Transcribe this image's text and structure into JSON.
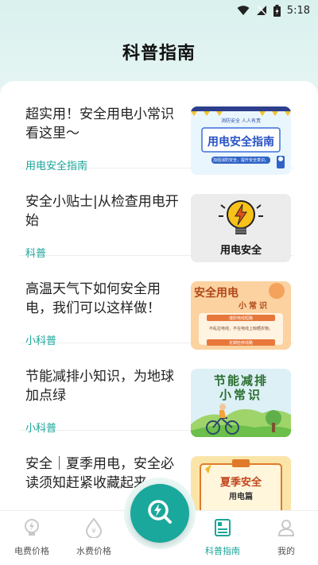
{
  "status_bar": {
    "time": "5:18"
  },
  "header": {
    "title": "科普指南"
  },
  "articles": [
    {
      "title": "超实用！安全用电小常识看这里～",
      "tag": "用电安全指南",
      "thumb": {
        "small": "消防安全 人人有责",
        "main": "用电安全指南",
        "note": "加强消防安全，提升安全意识。"
      }
    },
    {
      "title": "安全小贴士|从检查用电开始",
      "tag": "科普",
      "thumb": {
        "main": "用电安全"
      }
    },
    {
      "title": "高温天气下如何安全用电，我们可以这样做！",
      "tag": "小科普",
      "thumb": {
        "main": "安全用电",
        "sub": "小常识",
        "note1": "谨防电线短路",
        "note2": "不乱拉电线，不在电线上晾晒衣物。",
        "note3": "定期检修线路"
      }
    },
    {
      "title": "节能减排小知识，为地球加点绿",
      "tag": "小科普",
      "thumb": {
        "line1": "节能减排",
        "line2": "小常识"
      }
    },
    {
      "title": "安全｜夏季用电，安全必读须知赶紧收藏起来",
      "tag": "",
      "thumb": {
        "main": "夏季安全",
        "sub": "用电篇"
      }
    }
  ],
  "tabbar": {
    "tabs": [
      {
        "label": "电费价格",
        "icon": "electric-bill-icon"
      },
      {
        "label": "水费价格",
        "icon": "water-bill-icon"
      },
      {
        "label": "科普指南",
        "icon": "guide-book-icon",
        "active": true
      },
      {
        "label": "我的",
        "icon": "profile-icon"
      }
    ],
    "fab_icon": "search-bolt-icon"
  },
  "colors": {
    "accent": "#1aa69a",
    "fab": "#1aa89c"
  }
}
